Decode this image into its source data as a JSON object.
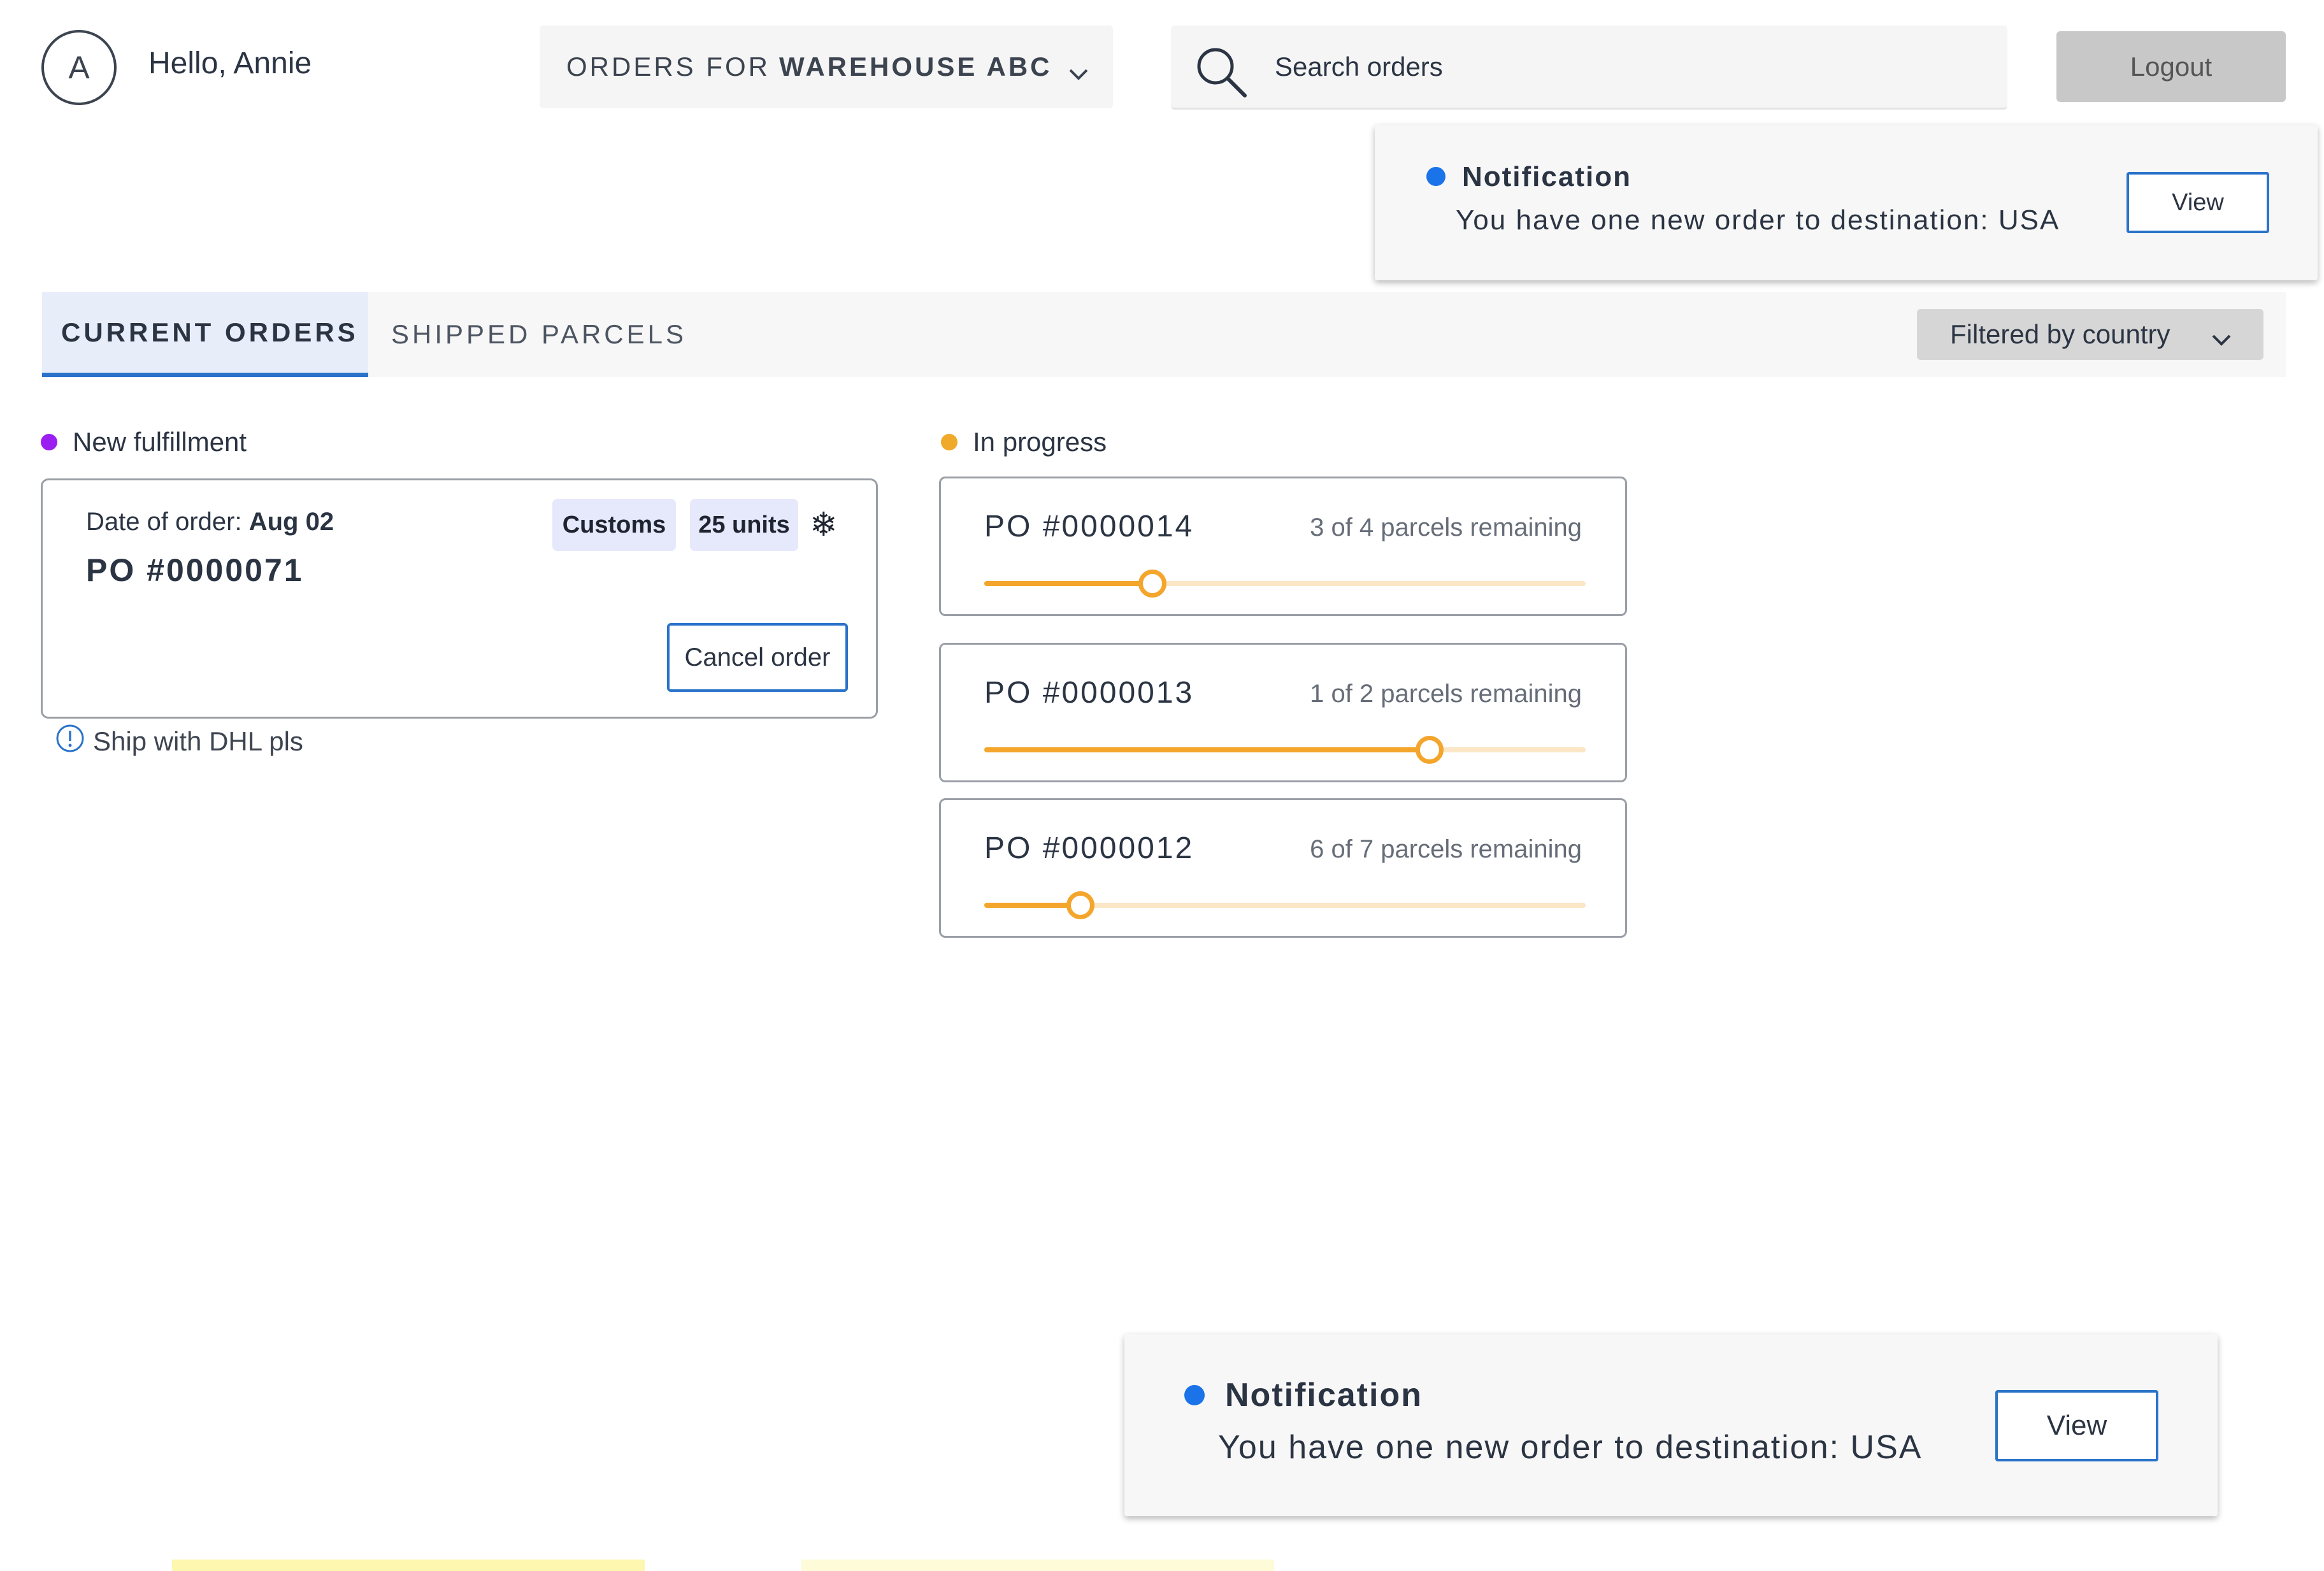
{
  "header": {
    "avatar_initial": "A",
    "greeting": "Hello, Annie",
    "warehouse_prefix": "ORDERS FOR",
    "warehouse_name": "WAREHOUSE ABC",
    "search_placeholder": "Search orders",
    "logout_label": "Logout"
  },
  "notifications": [
    {
      "title": "Notification",
      "message": "You have one new order to destination: USA",
      "action": "View"
    },
    {
      "title": "Notification",
      "message": "You have one new order to destination: USA",
      "action": "View"
    }
  ],
  "tabs": [
    {
      "label": "CURRENT ORDERS",
      "active": true
    },
    {
      "label": "SHIPPED PARCELS",
      "active": false
    }
  ],
  "filter_label": "Filtered by country",
  "columns": {
    "new": {
      "label": "New fulfillment",
      "dot_color": "#9b1ff0",
      "order": {
        "date_label": "Date of order:",
        "date_value": "Aug 02",
        "po": "PO #0000071",
        "tags": [
          "Customs",
          "25 units"
        ],
        "cancel_label": "Cancel order",
        "note": "Ship with DHL pls"
      }
    },
    "in_progress": {
      "label": "In progress",
      "dot_color": "#f0a928",
      "orders": [
        {
          "po": "PO #0000014",
          "remaining": "3 of 4 parcels remaining",
          "progress": 0.28
        },
        {
          "po": "PO #0000013",
          "remaining": "1 of 2 parcels remaining",
          "progress": 0.74
        },
        {
          "po": "PO #0000012",
          "remaining": "6 of 7 parcels remaining",
          "progress": 0.16
        }
      ]
    }
  },
  "colors": {
    "accent": "#2a73c9",
    "notification_dot": "#1a73e8",
    "progress": "#f4a52c",
    "progress_track": "#fbe6c6"
  }
}
